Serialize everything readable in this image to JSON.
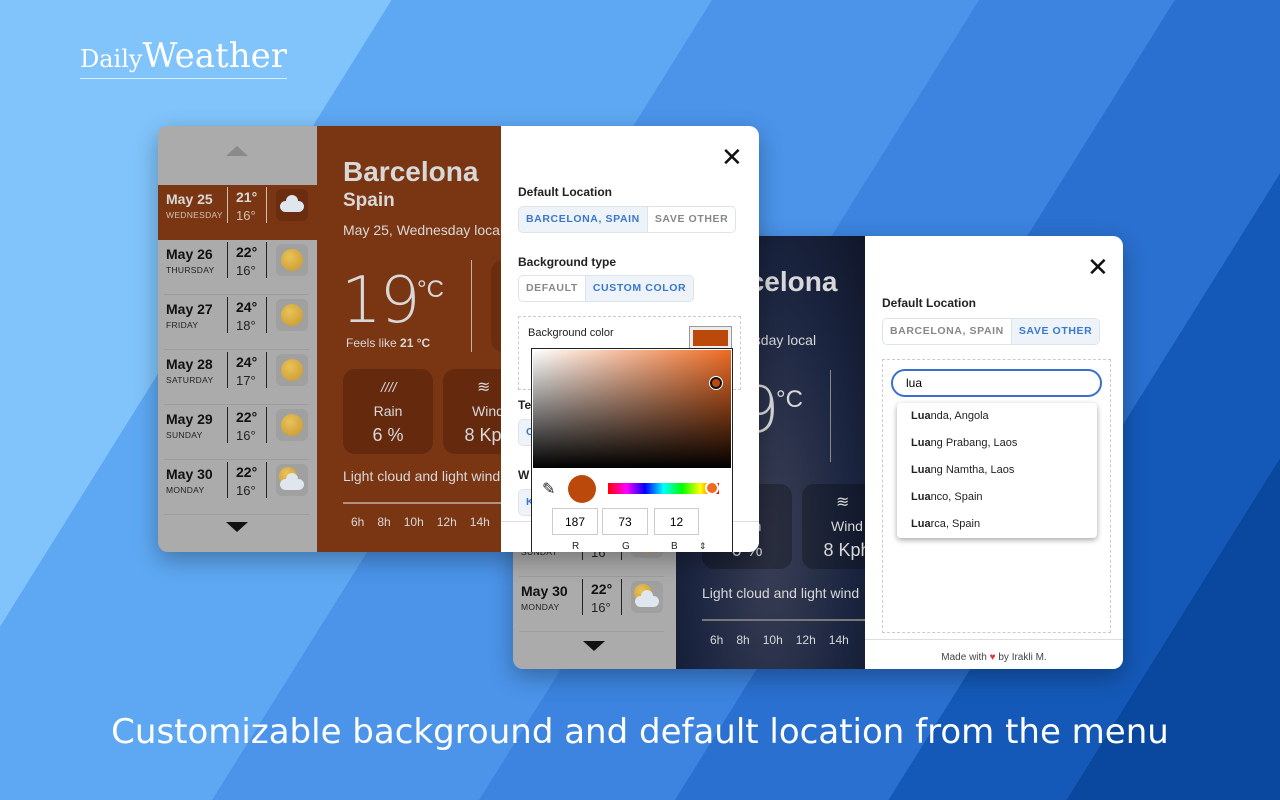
{
  "brand": {
    "part1": "Daily",
    "part2": "Weather"
  },
  "caption": "Customizable background and default location from the menu",
  "colors": {
    "custom_bg": "#bb490c",
    "accent": "#3a78cc",
    "night_bg": "#1b2540"
  },
  "forecast": [
    {
      "date": "May 25",
      "weekday": "WEDNESDAY",
      "high": "21°",
      "low": "16°",
      "icon": "cloud-icon"
    },
    {
      "date": "May 26",
      "weekday": "THURSDAY",
      "high": "22°",
      "low": "16°",
      "icon": "sun-icon"
    },
    {
      "date": "May 27",
      "weekday": "FRIDAY",
      "high": "24°",
      "low": "18°",
      "icon": "sun-icon"
    },
    {
      "date": "May 28",
      "weekday": "SATURDAY",
      "high": "24°",
      "low": "17°",
      "icon": "sun-icon"
    },
    {
      "date": "May 29",
      "weekday": "SUNDAY",
      "high": "22°",
      "low": "16°",
      "icon": "sun-icon"
    },
    {
      "date": "May 30",
      "weekday": "MONDAY",
      "high": "22°",
      "low": "16°",
      "icon": "partly-cloudy-icon"
    }
  ],
  "current": {
    "city": "Barcelona",
    "country": "Spain",
    "date": "May 25, Wednesday local",
    "temp": "19",
    "unit": "°C",
    "feels_label": "Feels like",
    "feels_value": "21 °C",
    "rain_label": "Rain",
    "rain_value": "6 %",
    "wind_label": "Wind",
    "wind_value": "8 Kph",
    "summary": "Light cloud and light wind",
    "hours": [
      "6h",
      "8h",
      "10h",
      "12h",
      "14h"
    ]
  },
  "settings": {
    "default_location_label": "Default Location",
    "loc_options": [
      "BARCELONA, SPAIN",
      "SAVE OTHER"
    ],
    "bg_type_label": "Background type",
    "bg_options": [
      "DEFAULT",
      "CUSTOM COLOR"
    ],
    "bg_color_label": "Background color",
    "partial_labels": [
      "Te",
      "W"
    ],
    "partial_buttons": [
      "C",
      "K"
    ],
    "picker": {
      "r": "187",
      "g": "73",
      "b": "12",
      "r_label": "R",
      "g_label": "G",
      "b_label": "B"
    }
  },
  "settings2": {
    "search_value": "lua",
    "suggestions": [
      {
        "match": "Lua",
        "rest": "nda, Angola"
      },
      {
        "match": "Lua",
        "rest": "ng Prabang, Laos"
      },
      {
        "match": "Lua",
        "rest": "ng Namtha, Laos"
      },
      {
        "match": "Lua",
        "rest": "nco, Spain"
      },
      {
        "match": "Lua",
        "rest": "rca, Spain"
      }
    ],
    "footer_pre": "Made with",
    "footer_post": "by Irakli M."
  }
}
